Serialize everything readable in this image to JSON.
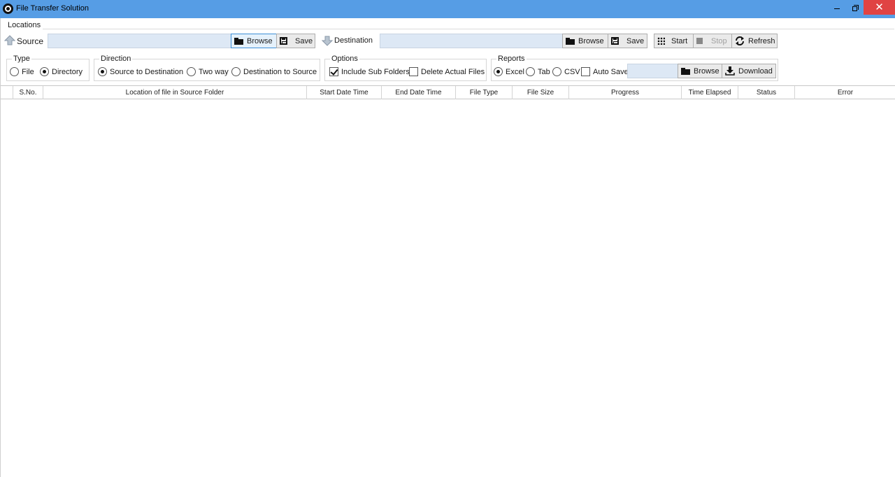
{
  "window": {
    "title": "File Transfer Solution",
    "close_glyph": "✕"
  },
  "locations": {
    "group_label": "Locations",
    "source": {
      "label": "Source",
      "value": "",
      "browse": "Browse",
      "save": "Save"
    },
    "destination": {
      "label": "Destination",
      "value": "",
      "browse": "Browse",
      "save": "Save"
    },
    "actions": {
      "start": "Start",
      "stop": "Stop",
      "refresh": "Refresh"
    }
  },
  "type": {
    "label": "Type",
    "options": [
      {
        "label": "File",
        "selected": false
      },
      {
        "label": "Directory",
        "selected": true
      }
    ]
  },
  "direction": {
    "label": "Direction",
    "options": [
      {
        "label": "Source to Destination",
        "selected": true
      },
      {
        "label": "Two way",
        "selected": false
      },
      {
        "label": "Destination to Source",
        "selected": false
      }
    ]
  },
  "options": {
    "label": "Options",
    "items": [
      {
        "label": "Include Sub Folders",
        "checked": true
      },
      {
        "label": "Delete Actual Files",
        "checked": false
      }
    ]
  },
  "reports": {
    "label": "Reports",
    "formats": [
      {
        "label": "Excel",
        "selected": true
      },
      {
        "label": "Tab",
        "selected": false
      },
      {
        "label": "CSV",
        "selected": false
      }
    ],
    "auto_save": {
      "label": "Auto Save",
      "checked": false
    },
    "path_value": "",
    "browse": "Browse",
    "download": "Download"
  },
  "grid": {
    "columns": [
      "",
      "S.No.",
      "Location of file in Source Folder",
      "Start Date Time",
      "End Date Time",
      "File Type",
      "File Size",
      "Progress",
      "Time Elapsed",
      "Status",
      "Error"
    ],
    "rows": []
  },
  "colors": {
    "titlebar": "#569de5",
    "close_button": "#e04343",
    "input_fill": "#dde8f5"
  },
  "icons": {
    "app": "app-logo-icon",
    "source": "arrow-up-icon",
    "destination": "arrow-down-icon",
    "browse": "folder-icon",
    "save": "floppy-disk-icon",
    "start": "grid-dots-icon",
    "stop": "stop-square-icon",
    "refresh": "refresh-icon",
    "download": "download-icon"
  }
}
